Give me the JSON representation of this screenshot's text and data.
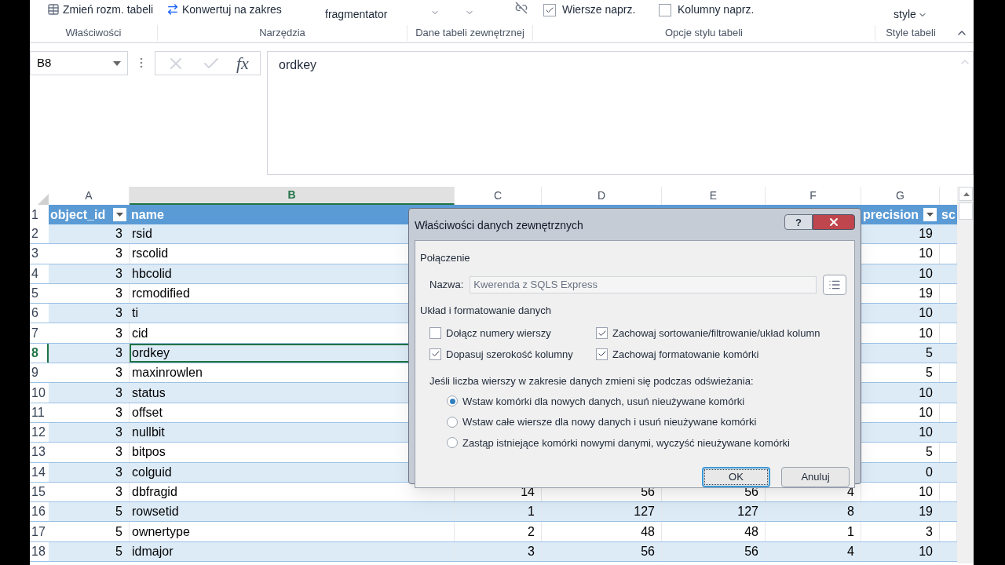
{
  "ribbon": {
    "items": [
      {
        "kind": "icon_button",
        "label": "Zmień rozm. tabeli"
      },
      {
        "kind": "icon_button",
        "label": "Konwertuj na zakres"
      },
      {
        "kind": "text_button",
        "label": "fragmentator"
      },
      {
        "kind": "caret_button"
      },
      {
        "kind": "caret_button"
      },
      {
        "kind": "unlink_button"
      },
      {
        "kind": "checkbox",
        "label": "Wiersze naprz.",
        "checked": true
      },
      {
        "kind": "checkbox",
        "label": "Kolumny naprz.",
        "checked": false
      },
      {
        "kind": "dropdown",
        "label": "style"
      }
    ],
    "groups": [
      "Właściwości",
      "Narzędzia",
      "Dane tabeli zewnętrznej",
      "Opcje stylu tabeli",
      "Style tabeli"
    ]
  },
  "formula_bar": {
    "name_box": "B8",
    "fx": "fx",
    "value": "ordkey"
  },
  "columns": [
    {
      "label": "A",
      "selected": false
    },
    {
      "label": "B",
      "selected": true
    },
    {
      "label": "C",
      "selected": false
    },
    {
      "label": "D",
      "selected": false
    },
    {
      "label": "E",
      "selected": false
    },
    {
      "label": "F",
      "selected": false
    },
    {
      "label": "G",
      "selected": false
    }
  ],
  "header_row": {
    "number": "1",
    "a": "object_id",
    "b": "name",
    "g": "precision",
    "h": "sc"
  },
  "rows": [
    {
      "number": "2",
      "selected": false,
      "a": "3",
      "b": "rsid",
      "g": "19"
    },
    {
      "number": "3",
      "selected": false,
      "a": "3",
      "b": "rscolid",
      "g": "10"
    },
    {
      "number": "4",
      "selected": false,
      "a": "3",
      "b": "hbcolid",
      "g": "10"
    },
    {
      "number": "5",
      "selected": false,
      "a": "3",
      "b": "rcmodified",
      "g": "19"
    },
    {
      "number": "6",
      "selected": false,
      "a": "3",
      "b": "ti",
      "g": "10"
    },
    {
      "number": "7",
      "selected": false,
      "a": "3",
      "b": "cid",
      "g": "10"
    },
    {
      "number": "8",
      "selected": true,
      "a": "3",
      "b": "ordkey",
      "g": "5"
    },
    {
      "number": "9",
      "selected": false,
      "a": "3",
      "b": "maxinrowlen",
      "g": "5"
    },
    {
      "number": "10",
      "selected": false,
      "a": "3",
      "b": "status",
      "g": "10"
    },
    {
      "number": "11",
      "selected": false,
      "a": "3",
      "b": "offset",
      "g": "10"
    },
    {
      "number": "12",
      "selected": false,
      "a": "3",
      "b": "nullbit",
      "g": "10"
    },
    {
      "number": "13",
      "selected": false,
      "a": "3",
      "b": "bitpos",
      "g": "5"
    },
    {
      "number": "14",
      "selected": false,
      "a": "3",
      "b": "colguid",
      "g": "0"
    },
    {
      "number": "15",
      "selected": false,
      "a": "3",
      "b": "dbfragid",
      "c": "14",
      "d": "56",
      "e": "56",
      "f": "4",
      "g": "10"
    },
    {
      "number": "16",
      "selected": false,
      "a": "5",
      "b": "rowsetid",
      "c": "1",
      "d": "127",
      "e": "127",
      "f": "8",
      "g": "19"
    },
    {
      "number": "17",
      "selected": false,
      "a": "5",
      "b": "ownertype",
      "c": "2",
      "d": "48",
      "e": "48",
      "f": "1",
      "g": "3"
    },
    {
      "number": "18",
      "selected": false,
      "a": "5",
      "b": "idmajor",
      "c": "3",
      "d": "56",
      "e": "56",
      "f": "4",
      "g": "10"
    }
  ],
  "dialog": {
    "title": "Właściwości danych zewnętrznych",
    "help": "?",
    "connection_heading": "Połączenie",
    "name_label": "Nazwa:",
    "name_value": "Kwerenda z SQLS Express",
    "layout_heading": "Układ i formatowanie danych",
    "options": [
      {
        "label": "Dołącz numery wierszy",
        "checked": false
      },
      {
        "label": "Zachowaj sortowanie/filtrowanie/układ kolumn",
        "checked": true
      },
      {
        "label": "Dopasuj szerokość kolumny",
        "checked": true
      },
      {
        "label": "Zachowaj formatowanie komórki",
        "checked": true
      }
    ],
    "refresh_label": "Jeśli liczba wierszy w zakresie danych zmieni się podczas odświeżania:",
    "radios": [
      {
        "label": "Wstaw komórki dla nowych danych, usuń nieużywane komórki",
        "selected": true
      },
      {
        "label": "Wstaw całe wiersze dla nowy danych i usuń nieużywane komórki",
        "selected": false
      },
      {
        "label": "Zastąp istniejące komórki nowymi danymi, wyczyść nieużywane komórki",
        "selected": false
      }
    ],
    "buttons": [
      {
        "label": "OK",
        "kind": "default"
      },
      {
        "label": "Anuluj",
        "kind": "normal"
      }
    ]
  }
}
